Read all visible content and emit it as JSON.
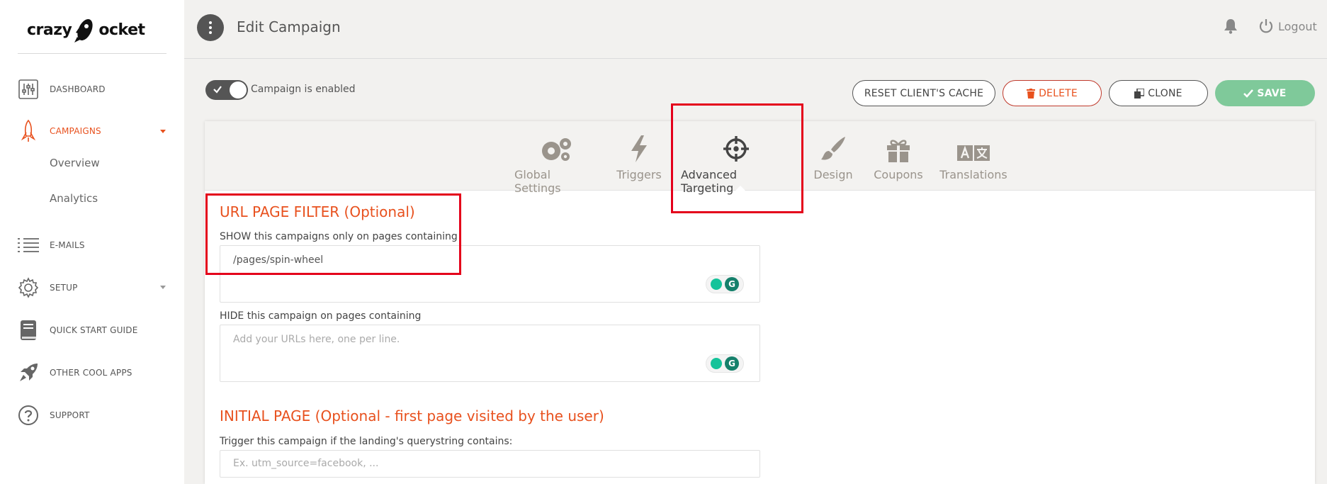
{
  "brand": {
    "name_left": "crazy",
    "name_right": "ocket",
    "accent": "#e8511e"
  },
  "sidebar": {
    "items": [
      {
        "label": "DASHBOARD",
        "icon": "sliders-icon"
      },
      {
        "label": "CAMPAIGNS",
        "icon": "rocket-outline-icon",
        "active": true
      },
      {
        "label": "E-MAILS",
        "icon": "list-icon"
      },
      {
        "label": "SETUP",
        "icon": "gear-icon"
      },
      {
        "label": "QUICK START GUIDE",
        "icon": "book-icon"
      },
      {
        "label": "OTHER COOL APPS",
        "icon": "rocket-icon"
      },
      {
        "label": "SUPPORT",
        "icon": "question-circle-icon"
      }
    ],
    "sub_items": [
      "Overview",
      "Analytics"
    ]
  },
  "header": {
    "title": "Edit Campaign",
    "logout_label": "Logout"
  },
  "toolbar": {
    "toggle_label": "Campaign is enabled",
    "toggle_on": true,
    "reset_label": "RESET CLIENT'S CACHE",
    "delete_label": "DELETE",
    "clone_label": "CLONE",
    "save_label": "SAVE"
  },
  "tabs": [
    {
      "label": "Global Settings",
      "icon": "gears-icon"
    },
    {
      "label": "Triggers",
      "icon": "lightning-icon"
    },
    {
      "label": "Advanced Targeting",
      "icon": "crosshair-icon",
      "active": true
    },
    {
      "label": "Design",
      "icon": "brush-icon"
    },
    {
      "label": "Coupons",
      "icon": "gift-icon"
    },
    {
      "label": "Translations",
      "icon": "language-icon"
    }
  ],
  "url_filter": {
    "title": "URL PAGE FILTER (Optional)",
    "show_label": "SHOW this campaigns only on pages containing",
    "show_value": "/pages/spin-wheel",
    "hide_label": "HIDE this campaign on pages containing",
    "hide_placeholder": "Add your URLs here, one per line."
  },
  "initial_page": {
    "title": "INITIAL PAGE (Optional - first page visited by the user)",
    "label": "Trigger this campaign if the landing's querystring contains:",
    "placeholder": "Ex. utm_source=facebook, ..."
  }
}
